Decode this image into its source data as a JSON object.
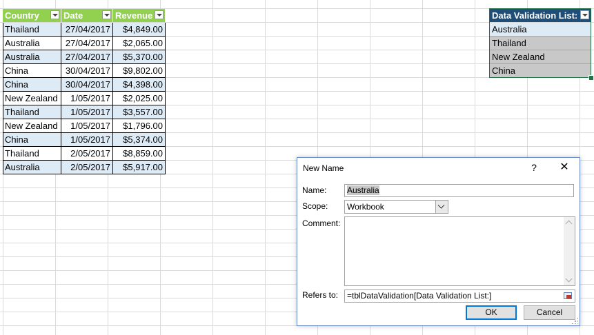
{
  "table1": {
    "headers": [
      "Country",
      "Date",
      "Revenue"
    ],
    "rows": [
      [
        "Thailand",
        "27/04/2017",
        "$4,849.00"
      ],
      [
        "Australia",
        "27/04/2017",
        "$2,065.00"
      ],
      [
        "Australia",
        "27/04/2017",
        "$5,370.00"
      ],
      [
        "China",
        "30/04/2017",
        "$9,802.00"
      ],
      [
        "China",
        "30/04/2017",
        "$4,398.00"
      ],
      [
        "New Zealand",
        "1/05/2017",
        "$2,025.00"
      ],
      [
        "Thailand",
        "1/05/2017",
        "$3,557.00"
      ],
      [
        "New Zealand",
        "1/05/2017",
        "$1,796.00"
      ],
      [
        "China",
        "1/05/2017",
        "$5,374.00"
      ],
      [
        "Thailand",
        "2/05/2017",
        "$8,859.00"
      ],
      [
        "Australia",
        "2/05/2017",
        "$5,917.00"
      ]
    ]
  },
  "table2": {
    "header": "Data Validation List:",
    "items": [
      "Australia",
      "Thailand",
      "New Zealand",
      "China"
    ]
  },
  "dialog": {
    "title": "New Name",
    "help": "?",
    "close": "✕",
    "name_label": "Name:",
    "name_value": "Australia",
    "scope_label": "Scope:",
    "scope_value": "Workbook",
    "comment_label": "Comment:",
    "comment_value": "",
    "refers_label": "Refers to:",
    "refers_value": "=tblDataValidation[Data Validation List:]",
    "ok_label": "OK",
    "cancel_label": "Cancel"
  },
  "colors": {
    "table1_header": "#92d050",
    "table2_header": "#1f4e79",
    "band": "#ddebf7",
    "selection": "#c8c8c8",
    "ok_border": "#0078d7"
  }
}
